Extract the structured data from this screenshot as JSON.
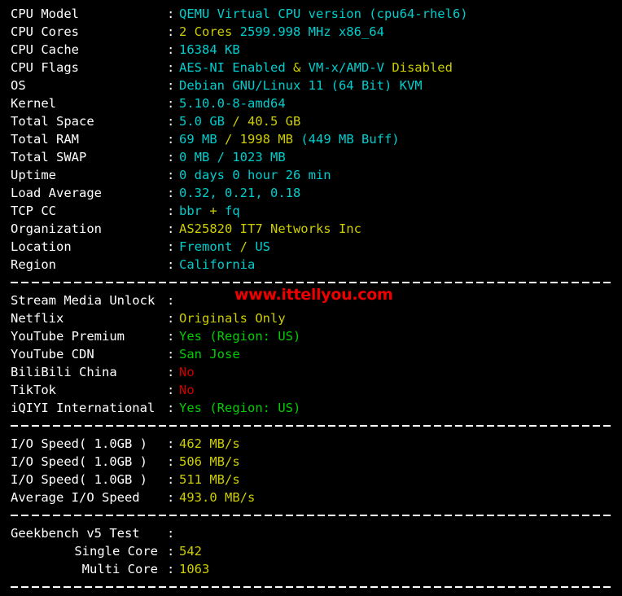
{
  "terminal": {
    "background_color": "#000000",
    "colors": {
      "label": "#ffffff",
      "cyan": "#00cdcd",
      "yellow": "#cdcd00",
      "green": "#00cd00",
      "red": "#cd0000",
      "watermark": "#ee0000"
    }
  },
  "watermark": {
    "text": "www.ittellyou.com"
  },
  "separator": {
    "char": "-"
  },
  "system_section": {
    "rows": [
      {
        "label": "CPU Model",
        "colon": ":",
        "segments": [
          {
            "text": "QEMU Virtual CPU version (cpu64-rhel6)",
            "color": "cyan"
          }
        ]
      },
      {
        "label": "CPU Cores",
        "colon": ":",
        "segments": [
          {
            "text": "2 Cores ",
            "color": "yellow"
          },
          {
            "text": "2599.998 MHz x86_64",
            "color": "cyan"
          }
        ]
      },
      {
        "label": "CPU Cache",
        "colon": ":",
        "segments": [
          {
            "text": "16384 KB",
            "color": "cyan"
          }
        ]
      },
      {
        "label": "CPU Flags",
        "colon": ":",
        "segments": [
          {
            "text": "AES-NI Enabled ",
            "color": "cyan"
          },
          {
            "text": "& ",
            "color": "yellow"
          },
          {
            "text": "VM-x/AMD-V ",
            "color": "cyan"
          },
          {
            "text": "Disabled",
            "color": "yellow"
          }
        ]
      },
      {
        "label": "OS",
        "colon": ":",
        "segments": [
          {
            "text": "Debian GNU/Linux 11 (64 Bit) KVM",
            "color": "cyan"
          }
        ]
      },
      {
        "label": "Kernel",
        "colon": ":",
        "segments": [
          {
            "text": "5.10.0-8-amd64",
            "color": "cyan"
          }
        ]
      },
      {
        "label": "Total Space",
        "colon": ":",
        "segments": [
          {
            "text": "5.0 GB ",
            "color": "cyan"
          },
          {
            "text": "/ 40.5 GB",
            "color": "yellow"
          }
        ]
      },
      {
        "label": "Total RAM",
        "colon": ":",
        "segments": [
          {
            "text": "69 MB ",
            "color": "cyan"
          },
          {
            "text": "/ 1998 MB ",
            "color": "yellow"
          },
          {
            "text": "(449 MB Buff)",
            "color": "cyan"
          }
        ]
      },
      {
        "label": "Total SWAP",
        "colon": ":",
        "segments": [
          {
            "text": "0 MB / 1023 MB",
            "color": "cyan"
          }
        ]
      },
      {
        "label": "Uptime",
        "colon": ":",
        "segments": [
          {
            "text": "0 days 0 hour 26 min",
            "color": "cyan"
          }
        ]
      },
      {
        "label": "Load Average",
        "colon": ":",
        "segments": [
          {
            "text": "0.32, 0.21, 0.18",
            "color": "cyan"
          }
        ]
      },
      {
        "label": "TCP CC",
        "colon": ":",
        "segments": [
          {
            "text": "bbr ",
            "color": "cyan"
          },
          {
            "text": "+ ",
            "color": "yellow"
          },
          {
            "text": "fq",
            "color": "cyan"
          }
        ]
      },
      {
        "label": "Organization",
        "colon": ":",
        "segments": [
          {
            "text": "AS25820 IT7 Networks Inc",
            "color": "yellow"
          }
        ]
      },
      {
        "label": "Location",
        "colon": ":",
        "segments": [
          {
            "text": "Fremont ",
            "color": "cyan"
          },
          {
            "text": "/ ",
            "color": "yellow"
          },
          {
            "text": "US",
            "color": "cyan"
          }
        ]
      },
      {
        "label": "Region",
        "colon": ":",
        "segments": [
          {
            "text": "California",
            "color": "cyan"
          }
        ]
      }
    ]
  },
  "stream_section": {
    "rows": [
      {
        "label": "Stream Media Unlock",
        "colon": ":",
        "segments": []
      },
      {
        "label": "Netflix",
        "colon": ":",
        "segments": [
          {
            "text": "Originals Only",
            "color": "yellow"
          }
        ]
      },
      {
        "label": "YouTube Premium",
        "colon": ":",
        "segments": [
          {
            "text": "Yes (Region: US)",
            "color": "green"
          }
        ]
      },
      {
        "label": "YouTube CDN",
        "colon": ":",
        "segments": [
          {
            "text": "San Jose",
            "color": "green"
          }
        ]
      },
      {
        "label": "BiliBili China",
        "colon": ":",
        "segments": [
          {
            "text": "No",
            "color": "red"
          }
        ]
      },
      {
        "label": "TikTok",
        "colon": ":",
        "segments": [
          {
            "text": "No",
            "color": "red"
          }
        ]
      },
      {
        "label": "iQIYI International",
        "colon": ":",
        "segments": [
          {
            "text": "Yes (Region: US)",
            "color": "green"
          }
        ]
      }
    ]
  },
  "io_section": {
    "rows": [
      {
        "label": "I/O Speed( 1.0GB )",
        "colon": ":",
        "segments": [
          {
            "text": "462 MB/s",
            "color": "yellow"
          }
        ]
      },
      {
        "label": "I/O Speed( 1.0GB )",
        "colon": ":",
        "segments": [
          {
            "text": "506 MB/s",
            "color": "yellow"
          }
        ]
      },
      {
        "label": "I/O Speed( 1.0GB )",
        "colon": ":",
        "segments": [
          {
            "text": "511 MB/s",
            "color": "yellow"
          }
        ]
      },
      {
        "label": "Average I/O Speed",
        "colon": ":",
        "segments": [
          {
            "text": "493.0 MB/s",
            "color": "yellow"
          }
        ]
      }
    ]
  },
  "geekbench_section": {
    "rows": [
      {
        "label": "Geekbench v5 Test",
        "colon": ":",
        "align": "left",
        "segments": []
      },
      {
        "label": "Single Core",
        "colon": ":",
        "align": "right",
        "segments": [
          {
            "text": "542",
            "color": "yellow"
          }
        ]
      },
      {
        "label": "Multi Core",
        "colon": ":",
        "align": "right",
        "segments": [
          {
            "text": "1063",
            "color": "yellow"
          }
        ]
      }
    ]
  }
}
